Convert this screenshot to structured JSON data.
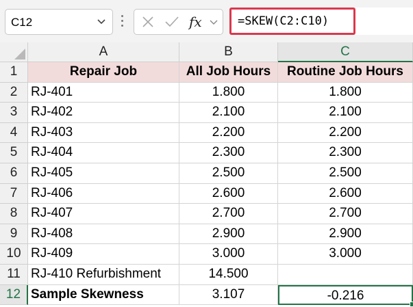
{
  "formula_bar": {
    "name_box": "C12",
    "cancel_symbol": "✕",
    "enter_symbol": "✓",
    "fx_label": "fx",
    "formula": "=SKEW(C2:C10)"
  },
  "sheet": {
    "column_headers": [
      "A",
      "B",
      "C"
    ],
    "selected_column": "C",
    "selected_row": "12",
    "rows": [
      {
        "row": "1",
        "a": "Repair Job",
        "b": "All Job Hours",
        "c": "Routine Job Hours"
      },
      {
        "row": "2",
        "a": "RJ-401",
        "b": "1.800",
        "c": "1.800"
      },
      {
        "row": "3",
        "a": "RJ-402",
        "b": "2.100",
        "c": "2.100"
      },
      {
        "row": "4",
        "a": "RJ-403",
        "b": "2.200",
        "c": "2.200"
      },
      {
        "row": "5",
        "a": "RJ-404",
        "b": "2.300",
        "c": "2.300"
      },
      {
        "row": "6",
        "a": "RJ-405",
        "b": "2.500",
        "c": "2.500"
      },
      {
        "row": "7",
        "a": "RJ-406",
        "b": "2.600",
        "c": "2.600"
      },
      {
        "row": "8",
        "a": "RJ-407",
        "b": "2.700",
        "c": "2.700"
      },
      {
        "row": "9",
        "a": "RJ-408",
        "b": "2.900",
        "c": "2.900"
      },
      {
        "row": "10",
        "a": "RJ-409",
        "b": "3.000",
        "c": "3.000"
      },
      {
        "row": "11",
        "a": "RJ-410 Refurbishment",
        "b": "14.500",
        "c": ""
      },
      {
        "row": "12",
        "a": "Sample Skewness",
        "b": "3.107",
        "c": "-0.216"
      }
    ]
  },
  "colors": {
    "header_fill": "#f2dcdb",
    "selection_green": "#217346",
    "formula_highlight": "#d9384d"
  }
}
